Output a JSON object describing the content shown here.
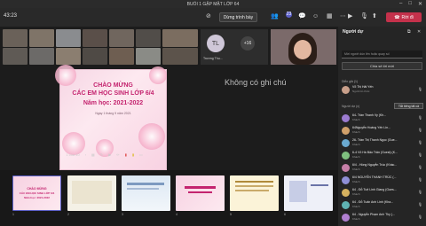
{
  "window": {
    "title": "BUỔI 1 GẶP MẶT LỚP 64"
  },
  "toolbar": {
    "timer": "43:23",
    "stop_label": "Dừng trình bày",
    "leave_label": "Rời đi",
    "badge_chat": "23",
    "leave_color": "#c4314b"
  },
  "stage": {
    "avatar_initials": "TL",
    "avatar_name": "Trương Thu...",
    "overflow_count": "+16",
    "notes_placeholder": "Không có ghi chú",
    "slide": {
      "line1": "CHÀO MỪNG",
      "line2": "CÁC EM HỌC SINH LỚP 6/4",
      "line3": "Năm học: 2021-2022",
      "date": "Ngày 1 tháng 9 năm 2021"
    },
    "slide_counter": "1 của 40",
    "thumb_numbers": [
      "1",
      "2",
      "3",
      "4",
      "5",
      "6"
    ]
  },
  "panel": {
    "title": "Người dự",
    "search_placeholder": "Mời người dùn lên hoặc quay số",
    "share_label": "Chia sẻ lời mời",
    "presenter_heading": "Diễn giả (1)",
    "presenter": {
      "name": "Võ Thị Hải Yến",
      "role": "Người tổ chức"
    },
    "attendee_heading": "Người dự (x)",
    "mute_all_label": "Tắt tiếng tất cả",
    "attendees": [
      {
        "name": "64- Trần Thanh Vy (Kh...",
        "role": "Khách"
      },
      {
        "name": "64Nguyễn Hoàng Yến Lin...",
        "role": "Khách"
      },
      {
        "name": "26- Trần Thị Thanh Ngọc (Gue...",
        "role": "Khách"
      },
      {
        "name": "6-4 Võ Hà Bảo Trân (Guest) (K...",
        "role": "Khách"
      },
      {
        "name": "6/4 - Hồng Nguyễn Trúc (Khác...",
        "role": "Khách"
      },
      {
        "name": "6/4 NGUYỄN THANH TRÚC (...",
        "role": "Khách"
      },
      {
        "name": "64 - Đỗ Tuệ Linh Giang (Gues...",
        "role": "Khách"
      },
      {
        "name": "64 - Đỗ Tuấn Anh Linh (Kha...",
        "role": "Khách"
      },
      {
        "name": "64 - Nguyễn Phạm Anh Thy (...",
        "role": "Khách"
      }
    ]
  }
}
